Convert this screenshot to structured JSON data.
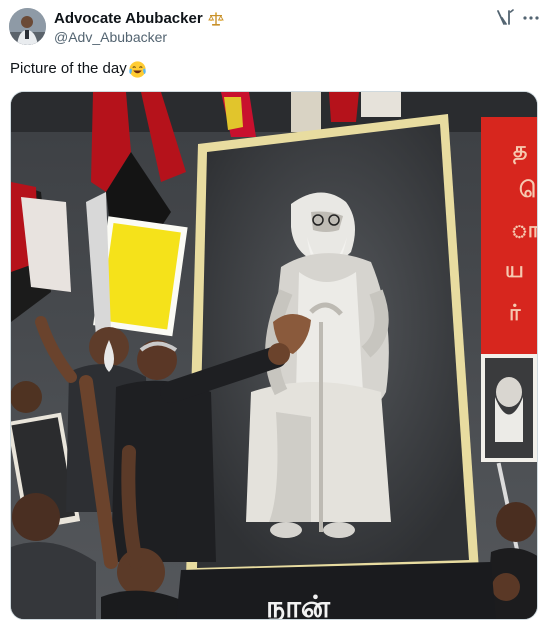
{
  "post": {
    "author": {
      "display_name": "Advocate Abubacker",
      "handle": "@Adv_Abubacker",
      "badge_icon": "scales-emoji-icon",
      "avatar_icon": "profile-photo"
    },
    "text": "Picture of the day",
    "text_emoji": "face-with-tears-of-joy-emoji",
    "header_icons": [
      "grok-icon",
      "more-options-icon"
    ],
    "media": {
      "kind": "photo",
      "banner_text": "நான்",
      "sign_text": [
        "த",
        "ெ",
        "ா",
        "ய",
        "ர்"
      ]
    }
  },
  "colors": {
    "text_primary": "#0f1419",
    "text_secondary": "#536471",
    "border": "#cfd9de",
    "flag_red": "#c8102e",
    "flag_black": "#111111",
    "sign_yellow": "#f5e21a",
    "portrait_bg": "#3d3f42",
    "frame_gold": "#e8dca0"
  }
}
